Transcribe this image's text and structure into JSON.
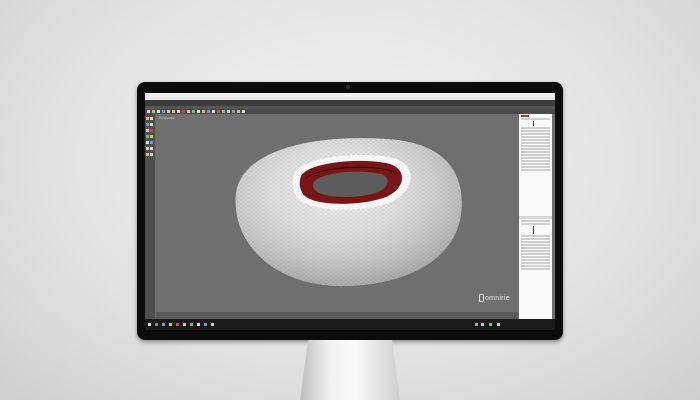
{
  "app": {
    "title": "Rhinoceros - stadium model",
    "viewport_label": "Perspective"
  },
  "watermark": {
    "logo_text": "omnirie"
  },
  "colors": {
    "viewport": "#6f6f6f",
    "bezel": "#0c0c0c",
    "inner_red": "#7a1515"
  }
}
